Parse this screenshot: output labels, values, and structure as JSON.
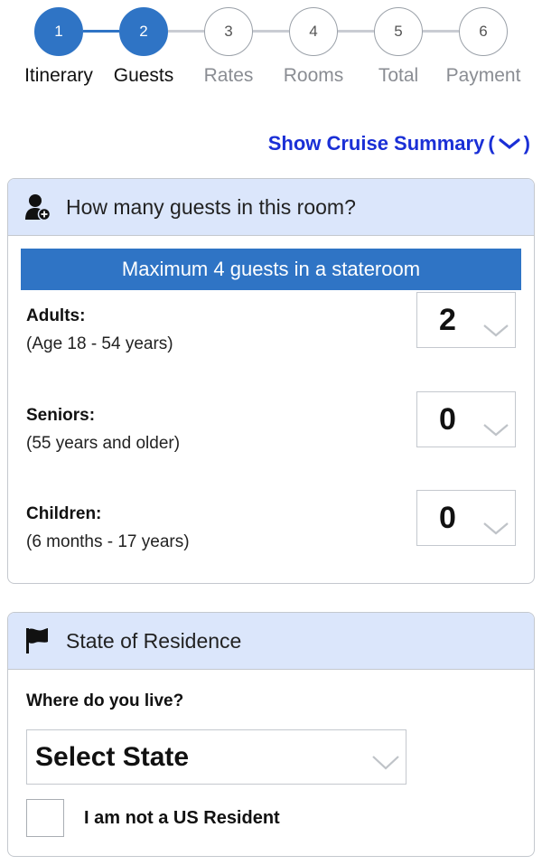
{
  "stepper": {
    "steps": [
      {
        "number": "1",
        "label": "Itinerary"
      },
      {
        "number": "2",
        "label": "Guests"
      },
      {
        "number": "3",
        "label": "Rates"
      },
      {
        "number": "4",
        "label": "Rooms"
      },
      {
        "number": "5",
        "label": "Total"
      },
      {
        "number": "6",
        "label": "Payment"
      }
    ]
  },
  "summary_link": {
    "label": "Show Cruise Summary",
    "icon": "chevron-down-icon",
    "prefix": "(",
    "suffix": "❯)"
  },
  "guests_card": {
    "title": "How many guests in this room?",
    "icon": "add-user-icon",
    "banner": "Maximum 4 guests in a stateroom",
    "rows": [
      {
        "title": "Adults:",
        "subtitle": "(Age 18 - 54 years)",
        "value": "2"
      },
      {
        "title": "Seniors:",
        "subtitle": "(55 years and older)",
        "value": "0"
      },
      {
        "title": "Children:",
        "subtitle": "(6 months - 17 years)",
        "value": "0"
      }
    ]
  },
  "residence_card": {
    "title": "State of Residence",
    "icon": "flag-icon",
    "question": "Where do you live?",
    "state_select": "Select State",
    "non_resident_label": "I am not a US Resident"
  },
  "colors": {
    "accent": "#2f74c5",
    "header_bg": "#dbe6fb",
    "link": "#1a2fd6"
  }
}
